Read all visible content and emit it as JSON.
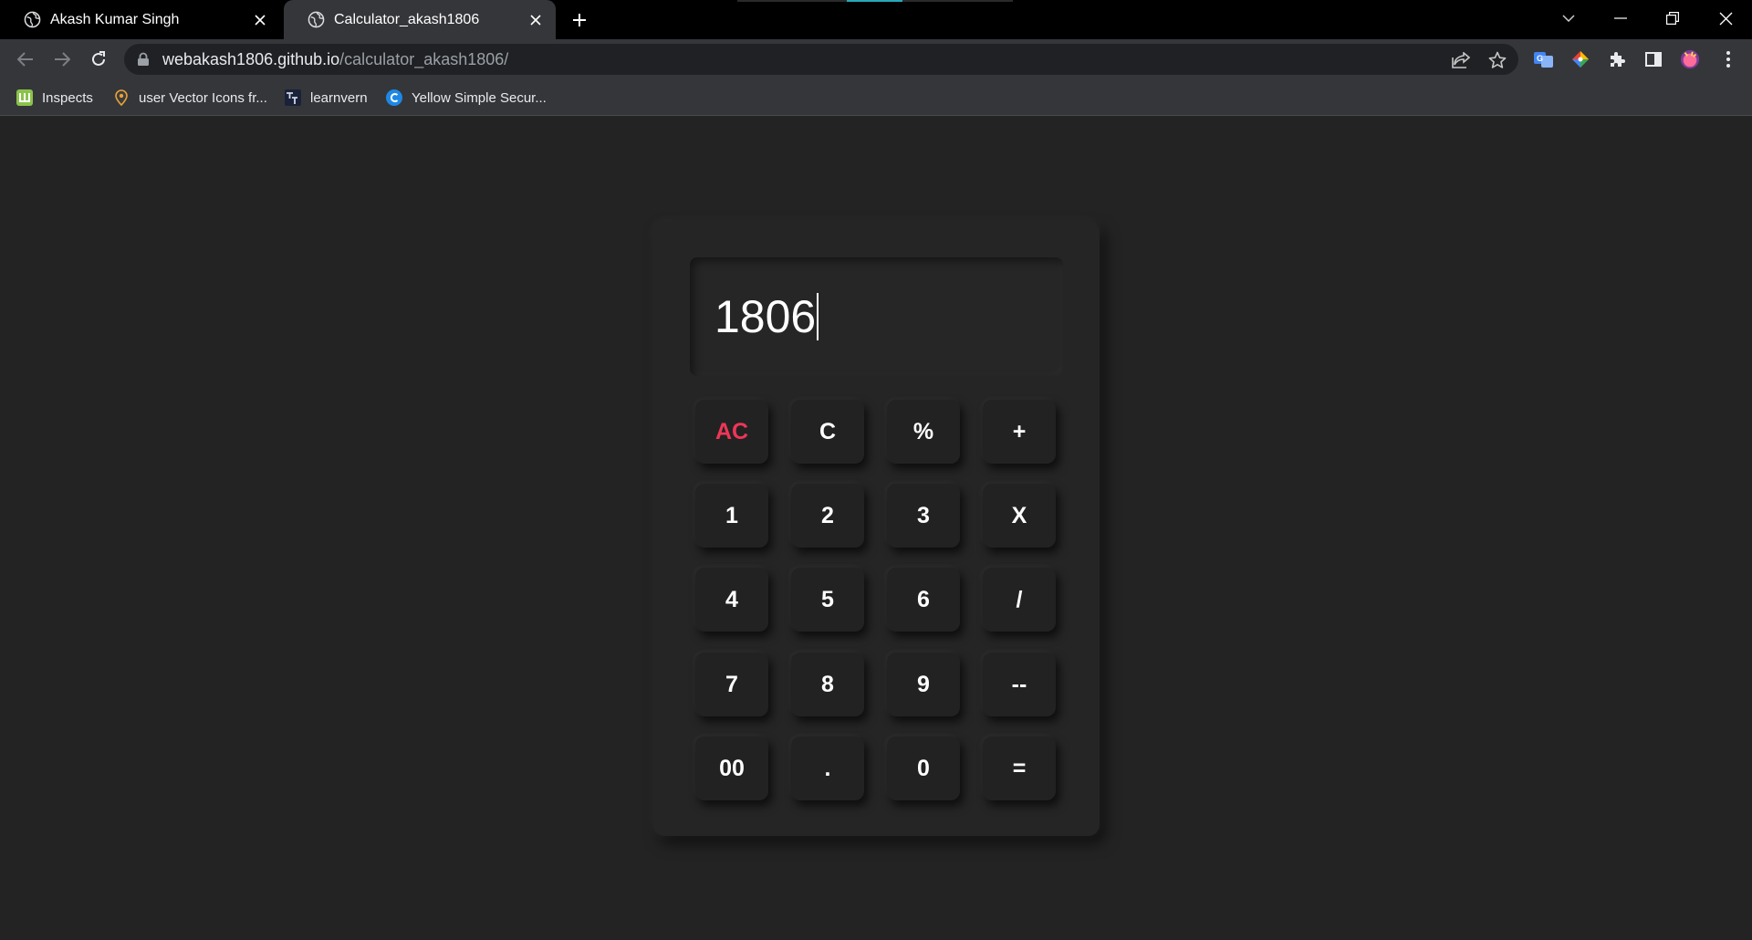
{
  "browser": {
    "tabs": [
      {
        "title": "Akash Kumar Singh",
        "active": false
      },
      {
        "title": "Calculator_akash1806",
        "active": true
      }
    ],
    "url": {
      "host": "webakash1806.github.io",
      "path": "/calculator_akash1806/"
    },
    "bookmarks": [
      {
        "label": "Inspects",
        "icon": "inspects-icon"
      },
      {
        "label": "user Vector Icons fr...",
        "icon": "location-pin-icon"
      },
      {
        "label": "learnvern",
        "icon": "learnvern-icon"
      },
      {
        "label": "Yellow Simple Secur...",
        "icon": "canva-icon"
      }
    ]
  },
  "calculator": {
    "display": "1806",
    "keys": [
      [
        "AC",
        "C",
        "%",
        "+"
      ],
      [
        "1",
        "2",
        "3",
        "X"
      ],
      [
        "4",
        "5",
        "6",
        "/"
      ],
      [
        "7",
        "8",
        "9",
        "--"
      ],
      [
        "00",
        ".",
        "0",
        "="
      ]
    ],
    "colors": {
      "accent_ac": "#ee3658",
      "background": "#232323",
      "key": "#222222"
    }
  }
}
